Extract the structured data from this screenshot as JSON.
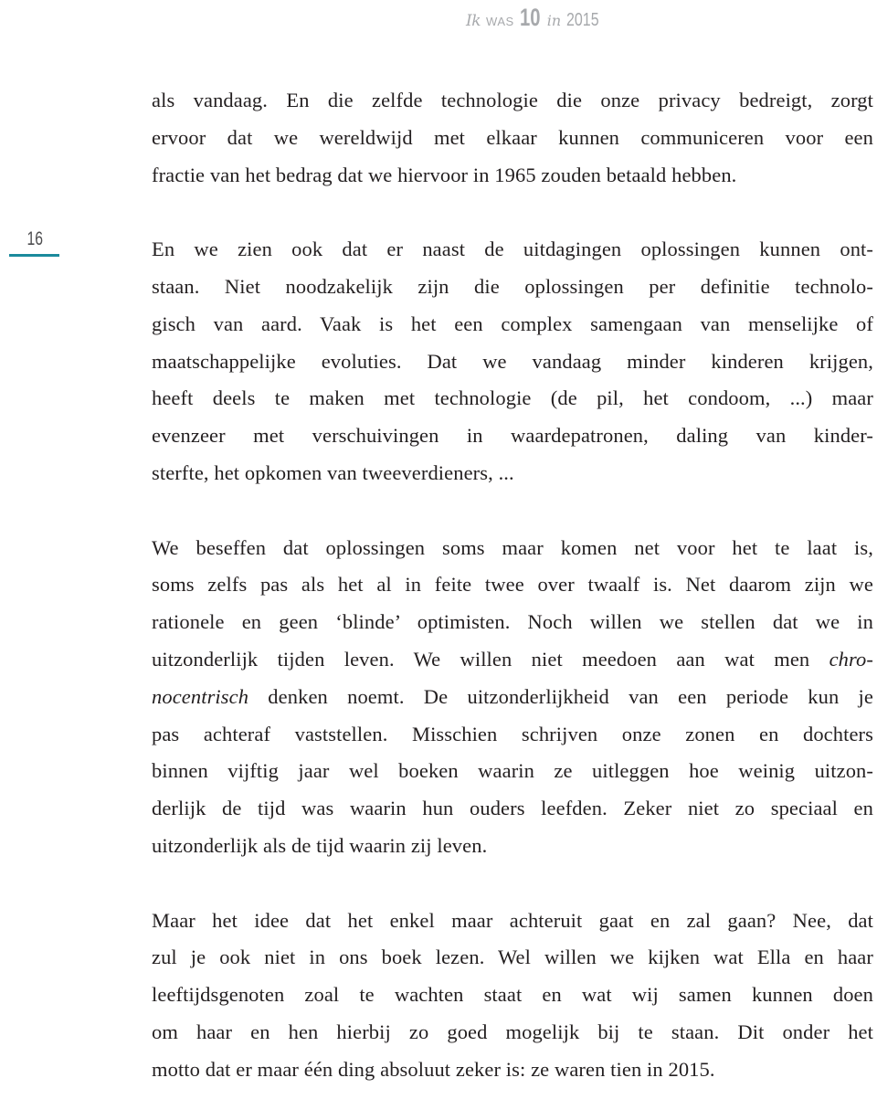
{
  "header": {
    "part1": "Ik",
    "part2": "WAS",
    "part3": "10",
    "part4": "in",
    "part5": "2015"
  },
  "page_number": "16",
  "accent_color": "#1b8a9c",
  "paragraphs": [
    {
      "lines": [
        "als vandaag. En die zelfde technologie die onze privacy bedreigt, zorgt",
        "ervoor dat we wereldwijd met elkaar kunnen communiceren voor een",
        "fractie van het bedrag dat we hiervoor in 1965 zouden betaald hebben."
      ]
    },
    {
      "lines": [
        "En we zien ook dat er naast de uitdagingen oplossingen kunnen ont-",
        "staan. Niet noodzakelijk zijn die oplossingen per definitie technolo-",
        "gisch van aard. Vaak is het een complex samengaan van menselijke of",
        "maatschappelijke evoluties. Dat we vandaag minder kinderen krijgen,",
        "heeft deels te maken met technologie (de pil, het condoom, ...) maar",
        "evenzeer met verschuivingen in waardepatronen, daling van kinder-",
        "sterfte, het opkomen van tweeverdieners, ..."
      ]
    },
    {
      "lines": [
        "We beseffen dat oplossingen soms maar komen net voor het te laat is,",
        "soms zelfs pas als het al in feite twee over twaalf is. Net daarom zijn we",
        "rationele en geen ‘blinde’ optimisten. Noch willen we stellen dat we in",
        "uitzonderlijk tijden leven. We willen niet meedoen aan wat men "
      ],
      "italic_a": "chro-",
      "italic_b": "nocentrisch",
      "lines_after": [
        " denken noemt. De uitzonderlijkheid van een periode kun je",
        "pas achteraf vaststellen. Misschien schrijven onze zonen en dochters",
        "binnen vijftig jaar wel boeken waarin ze uitleggen hoe weinig uitzon-",
        "derlijk de tijd was waarin hun ouders leefden. Zeker niet zo speciaal en",
        "uitzonderlijk als de tijd waarin zij leven."
      ]
    },
    {
      "lines": [
        "Maar het idee dat het enkel maar achteruit gaat en zal gaan? Nee, dat",
        "zul je ook niet in ons boek lezen. Wel willen we kijken wat Ella en haar",
        "leeftijdsgenoten zoal te wachten staat en wat wij samen kunnen doen",
        "om haar en hen hierbij zo goed mogelijk bij te staan. Dit onder het",
        "motto dat er maar één ding absoluut zeker is: ze waren tien in 2015."
      ]
    }
  ]
}
